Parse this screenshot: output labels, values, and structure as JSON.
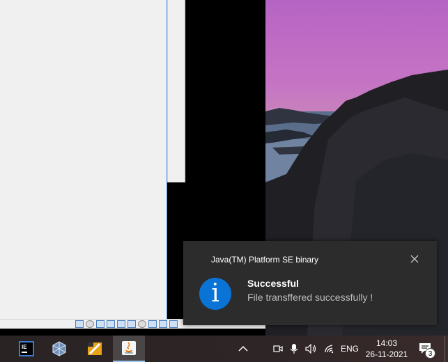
{
  "toast": {
    "app_name": "Java(TM) Platform SE binary",
    "title": "Successful",
    "message": "File transffered successfully !",
    "icon": "info-icon",
    "accent": "#0a74d6"
  },
  "taskbar": {
    "apps": [
      {
        "name": "intellij-idea",
        "icon": "intellij-icon"
      },
      {
        "name": "virtualbox",
        "icon": "virtualbox-icon"
      },
      {
        "name": "code-editor",
        "icon": "editor-icon"
      },
      {
        "name": "java",
        "icon": "java-icon",
        "active": true
      }
    ],
    "tray": {
      "input_language": "ENG",
      "time": "14:03",
      "date": "26-11-2021",
      "notification_count": "3"
    }
  },
  "colors": {
    "taskbar_bg": "#2b2424",
    "toast_bg": "#2c2c2c",
    "active_indicator": "#9cc4ea"
  }
}
